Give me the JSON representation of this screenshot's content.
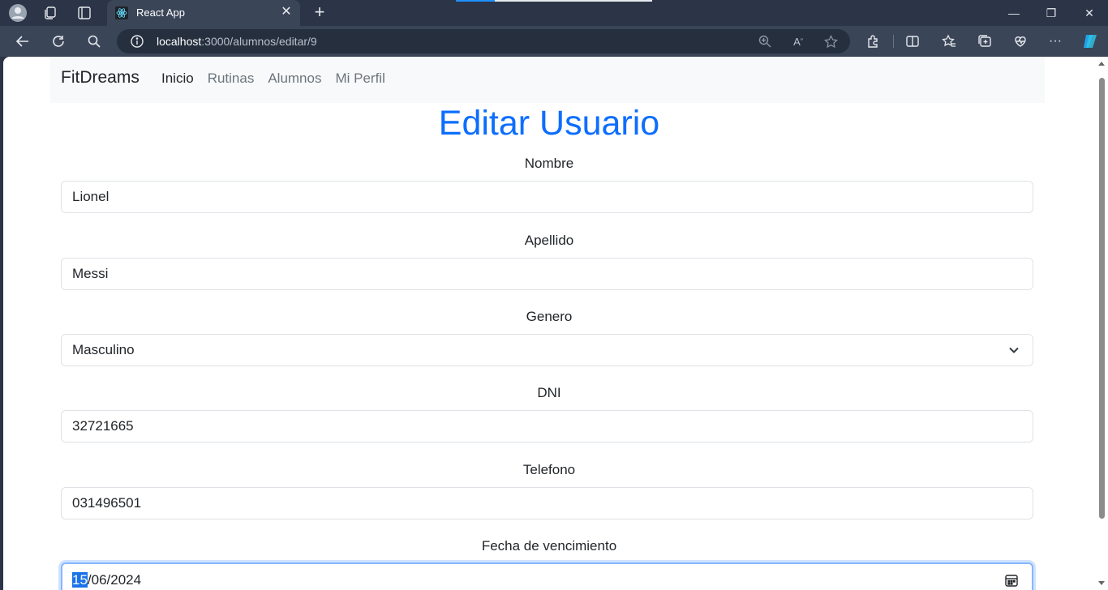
{
  "browser": {
    "tab_title": "React App",
    "url_host": "localhost",
    "url_path": ":3000/alumnos/editar/9"
  },
  "navbar": {
    "brand": "FitDreams",
    "links": [
      {
        "label": "Inicio",
        "active": true
      },
      {
        "label": "Rutinas",
        "active": false
      },
      {
        "label": "Alumnos",
        "active": false
      },
      {
        "label": "Mi Perfil",
        "active": false
      }
    ]
  },
  "page": {
    "title": "Editar Usuario"
  },
  "form": {
    "nombre": {
      "label": "Nombre",
      "value": "Lionel"
    },
    "apellido": {
      "label": "Apellido",
      "value": "Messi"
    },
    "genero": {
      "label": "Genero",
      "value": "Masculino"
    },
    "dni": {
      "label": "DNI",
      "value": "32721665"
    },
    "telefono": {
      "label": "Telefono",
      "value": "031496501"
    },
    "fecha": {
      "label": "Fecha de vencimiento",
      "day": "15",
      "rest": "/06/2024"
    }
  },
  "colors": {
    "primary": "#0d6efd",
    "navbar_bg": "#f8f9fa",
    "browser_chrome": "#2b3547"
  }
}
